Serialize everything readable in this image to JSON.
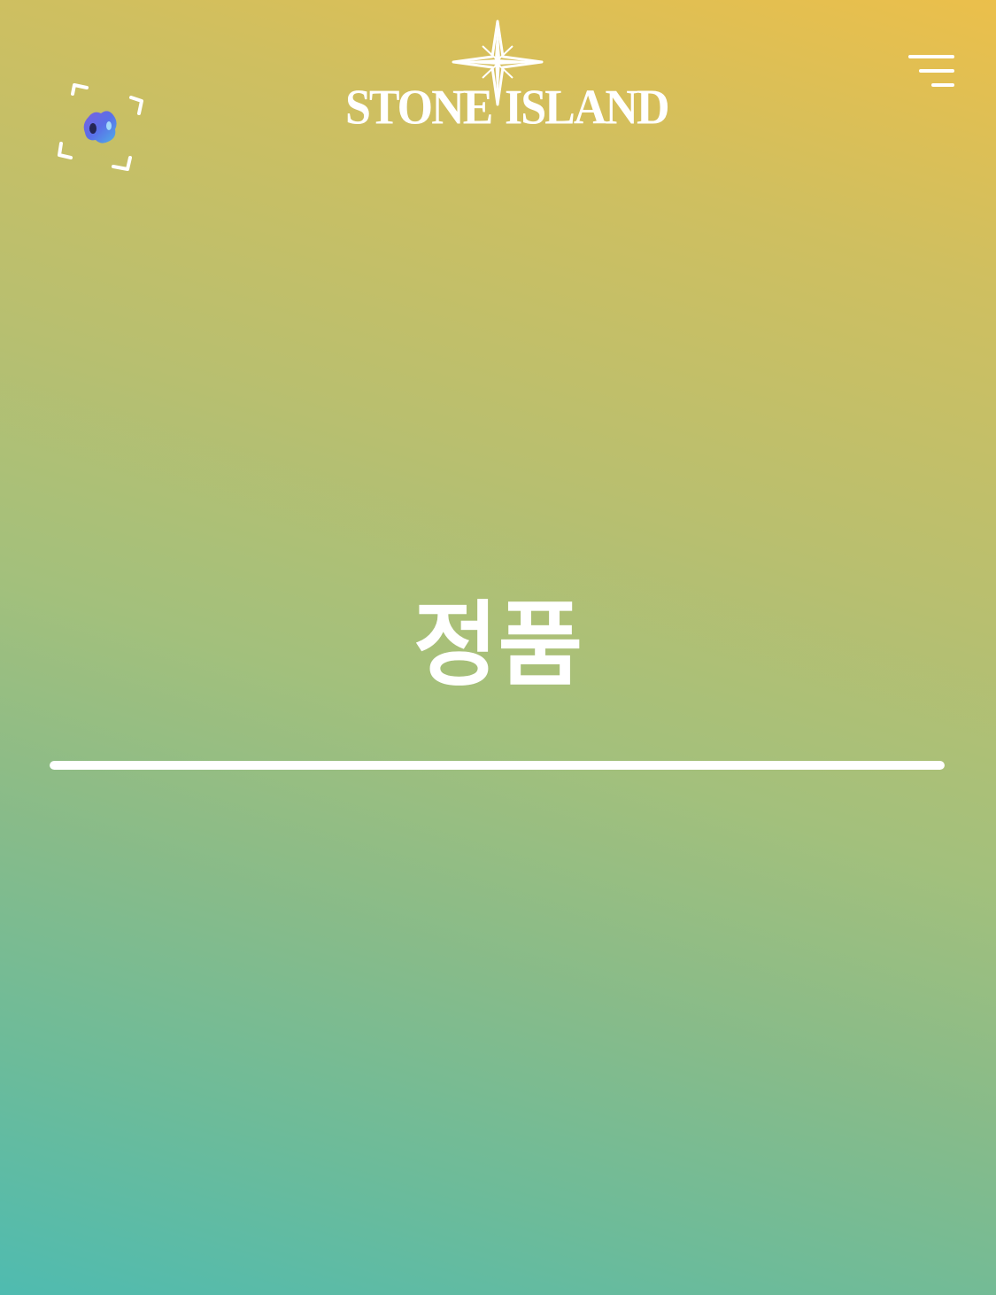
{
  "app": {
    "brand_left": "STONE",
    "brand_right": "ISLAND"
  },
  "header": {
    "scan_icon": "ar-scan-icon",
    "menu_icon": "hamburger-menu-icon"
  },
  "main": {
    "title": "정품",
    "progress_fraction": 1.0
  },
  "colors": {
    "gradient_top": "#ebbf4b",
    "gradient_bottom": "#4fbbb0",
    "foreground": "#ffffff"
  }
}
